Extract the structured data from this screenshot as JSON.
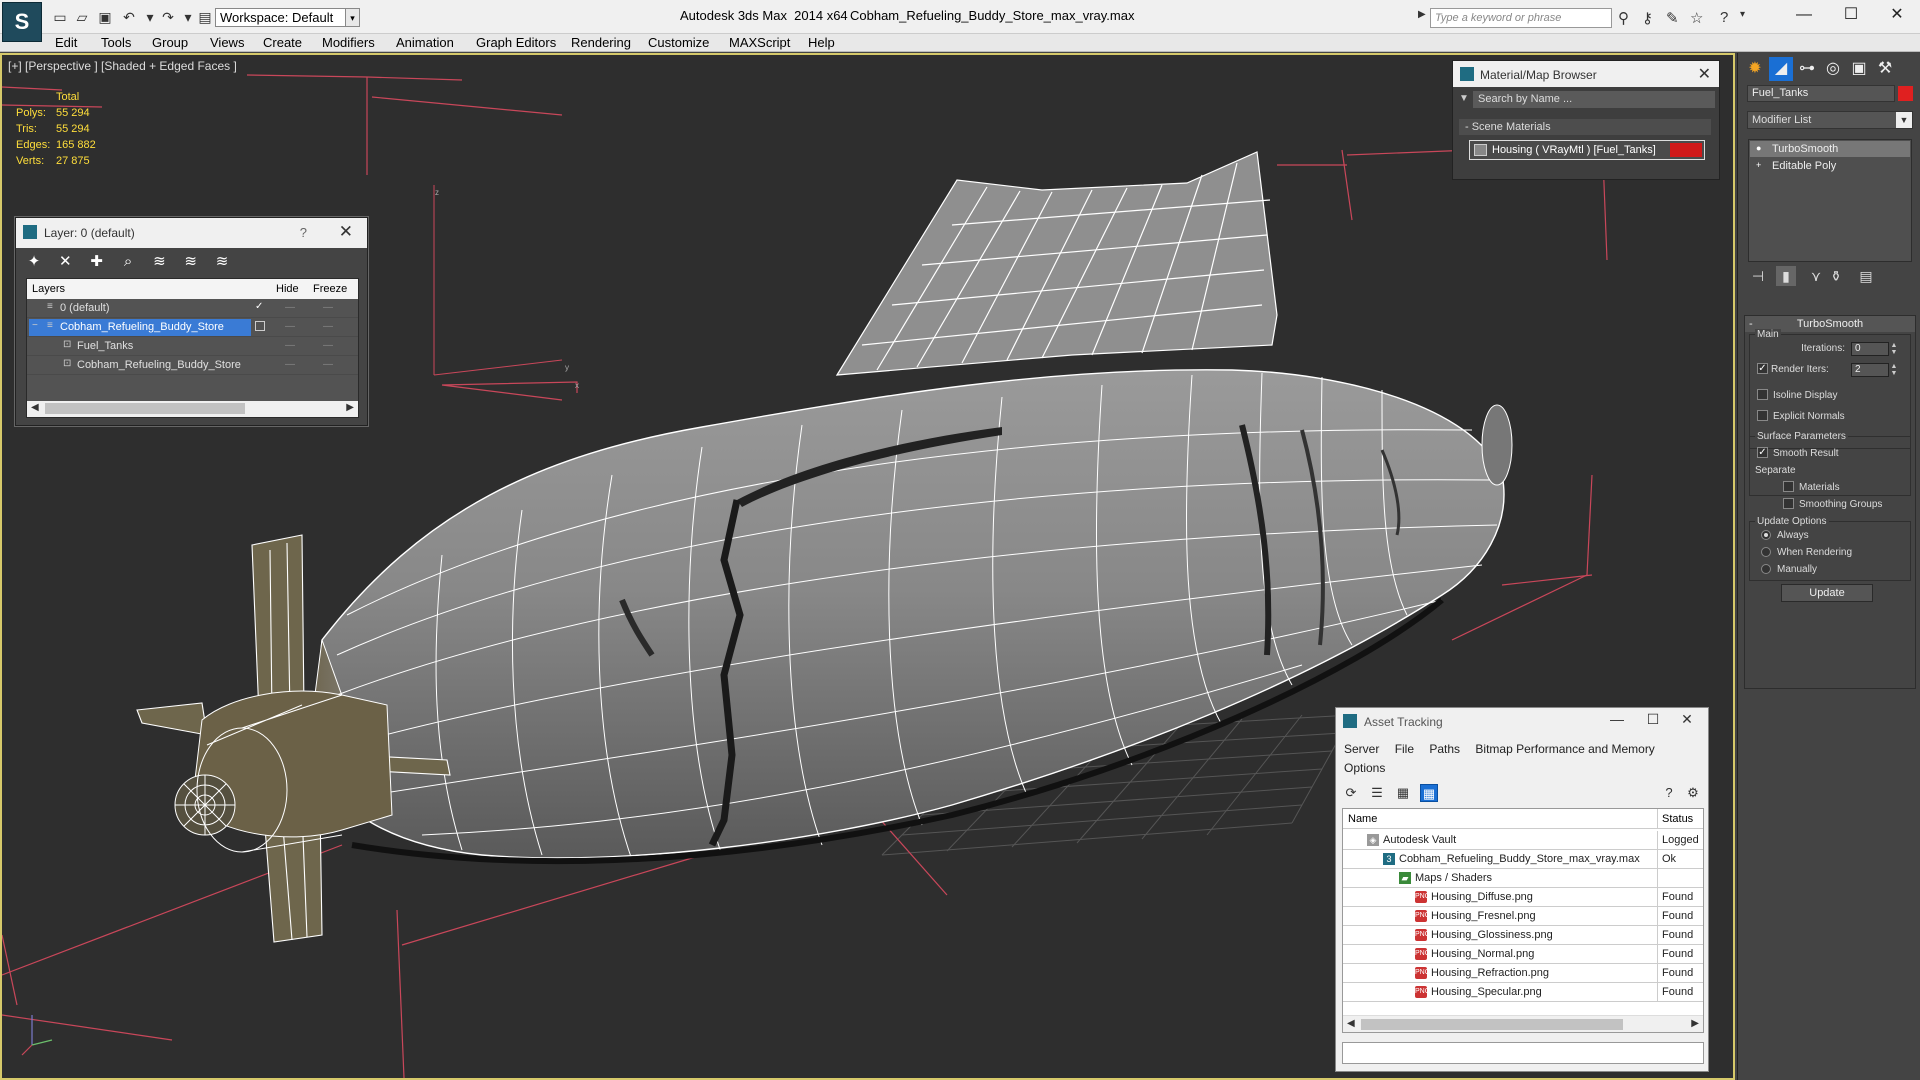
{
  "app": {
    "title": "Autodesk 3ds Max  2014 x64",
    "file": "Cobham_Refueling_Buddy_Store_max_vray.max",
    "logo_icon": "3dsmax-logo-icon",
    "workspace": "Workspace: Default",
    "search_placeholder": "Type a keyword or phrase"
  },
  "menu": [
    "Edit",
    "Tools",
    "Group",
    "Views",
    "Create",
    "Modifiers",
    "Animation",
    "Graph Editors",
    "Rendering",
    "Customize",
    "MAXScript",
    "Help"
  ],
  "viewport": {
    "label": "[+] [Perspective ] [Shaded + Edged Faces ]",
    "stats": {
      "header": "Total",
      "rows": [
        {
          "label": "Polys:",
          "value": "55 294"
        },
        {
          "label": "Tris:",
          "value": "55 294"
        },
        {
          "label": "Edges:",
          "value": "165 882"
        },
        {
          "label": "Verts:",
          "value": "27 875"
        }
      ]
    },
    "axis_labels": {
      "z": "z",
      "y": "y",
      "x": "x"
    },
    "colors": {
      "background": "#2e2e2e",
      "active_border": "#d6c96a",
      "stats_text": "#ffde3b"
    }
  },
  "layer_window": {
    "title": "Layer: 0 (default)",
    "help": "?",
    "columns": {
      "layers": "Layers",
      "hide": "Hide",
      "freeze": "Freeze"
    },
    "rows": [
      {
        "name": "0 (default)",
        "selected": false
      },
      {
        "name": "Cobham_Refueling_Buddy_Store",
        "selected": true
      },
      {
        "name": "Fuel_Tanks",
        "selected": false
      },
      {
        "name": "Cobham_Refueling_Buddy_Store",
        "selected": false
      }
    ],
    "dash": "—"
  },
  "material_browser": {
    "title": "Material/Map Browser",
    "search": "Search by Name ...",
    "group": "- Scene Materials",
    "item": "Housing  ( VRayMtl ) [Fuel_Tanks]",
    "swatch_color": "#d01818"
  },
  "command_panel": {
    "object_name": "Fuel_Tanks",
    "object_color": "#e02020",
    "modifier_list": "Modifier List",
    "stack": [
      "TurboSmooth",
      "Editable Poly"
    ],
    "turbosmooth": {
      "header": "TurboSmooth",
      "main_label": "Main",
      "iterations_label": "Iterations:",
      "iterations_value": "0",
      "render_iters_label": "Render Iters:",
      "render_iters_value": "2",
      "render_iters_checked": true,
      "isoline_label": "Isoline Display",
      "isoline_checked": false,
      "explicit_label": "Explicit Normals",
      "explicit_checked": false,
      "surface_label": "Surface Parameters",
      "smooth_result_label": "Smooth Result",
      "smooth_result_checked": true,
      "separate_label": "Separate",
      "materials_label": "Materials",
      "materials_checked": false,
      "smoothing_groups_label": "Smoothing Groups",
      "smoothing_groups_checked": false,
      "update_options_label": "Update Options",
      "update_always": "Always",
      "update_when_rendering": "When Rendering",
      "update_manually": "Manually",
      "update_selected": "Always",
      "update_button": "Update"
    }
  },
  "asset_tracking": {
    "title": "Asset Tracking",
    "menu": [
      "Server",
      "File",
      "Paths",
      "Bitmap Performance and Memory",
      "Options"
    ],
    "columns": {
      "name": "Name",
      "status": "Status"
    },
    "rows": [
      {
        "name": "Autodesk Vault",
        "status": "Logged",
        "level": 0,
        "icon": "vault-icon"
      },
      {
        "name": "Cobham_Refueling_Buddy_Store_max_vray.max",
        "status": "Ok",
        "level": 1,
        "icon": "max-file-icon"
      },
      {
        "name": "Maps / Shaders",
        "status": "",
        "level": 2,
        "icon": "maps-folder-icon"
      },
      {
        "name": "Housing_Diffuse.png",
        "status": "Found",
        "level": 3,
        "icon": "png-icon"
      },
      {
        "name": "Housing_Fresnel.png",
        "status": "Found",
        "level": 3,
        "icon": "png-icon"
      },
      {
        "name": "Housing_Glossiness.png",
        "status": "Found",
        "level": 3,
        "icon": "png-icon"
      },
      {
        "name": "Housing_Normal.png",
        "status": "Found",
        "level": 3,
        "icon": "png-icon"
      },
      {
        "name": "Housing_Refraction.png",
        "status": "Found",
        "level": 3,
        "icon": "png-icon"
      },
      {
        "name": "Housing_Specular.png",
        "status": "Found",
        "level": 3,
        "icon": "png-icon"
      }
    ]
  }
}
